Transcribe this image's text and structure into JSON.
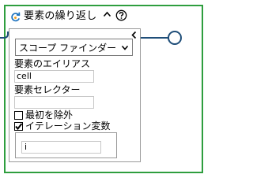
{
  "header": {
    "title": "要素の繰り返し",
    "loop_icon": "loop-icon",
    "collapse_icon": "chevron-up-icon",
    "help_icon": "help-icon"
  },
  "panel": {
    "collapse_icon": "chevron-left-icon",
    "scope_dropdown": {
      "selected": "スコープ ファインダー"
    },
    "alias": {
      "label": "要素のエイリアス",
      "value": "cell"
    },
    "selector": {
      "label": "要素セレクター",
      "value": ""
    },
    "exclude_first": {
      "label": "最初を除外",
      "checked": false
    },
    "iteration_var": {
      "label": "イテレーション変数",
      "checked": true,
      "value": "i"
    }
  },
  "colors": {
    "frame_green": "#2e9e3e",
    "connector_blue": "#1f4e79",
    "icon_blue": "#1e73be"
  }
}
